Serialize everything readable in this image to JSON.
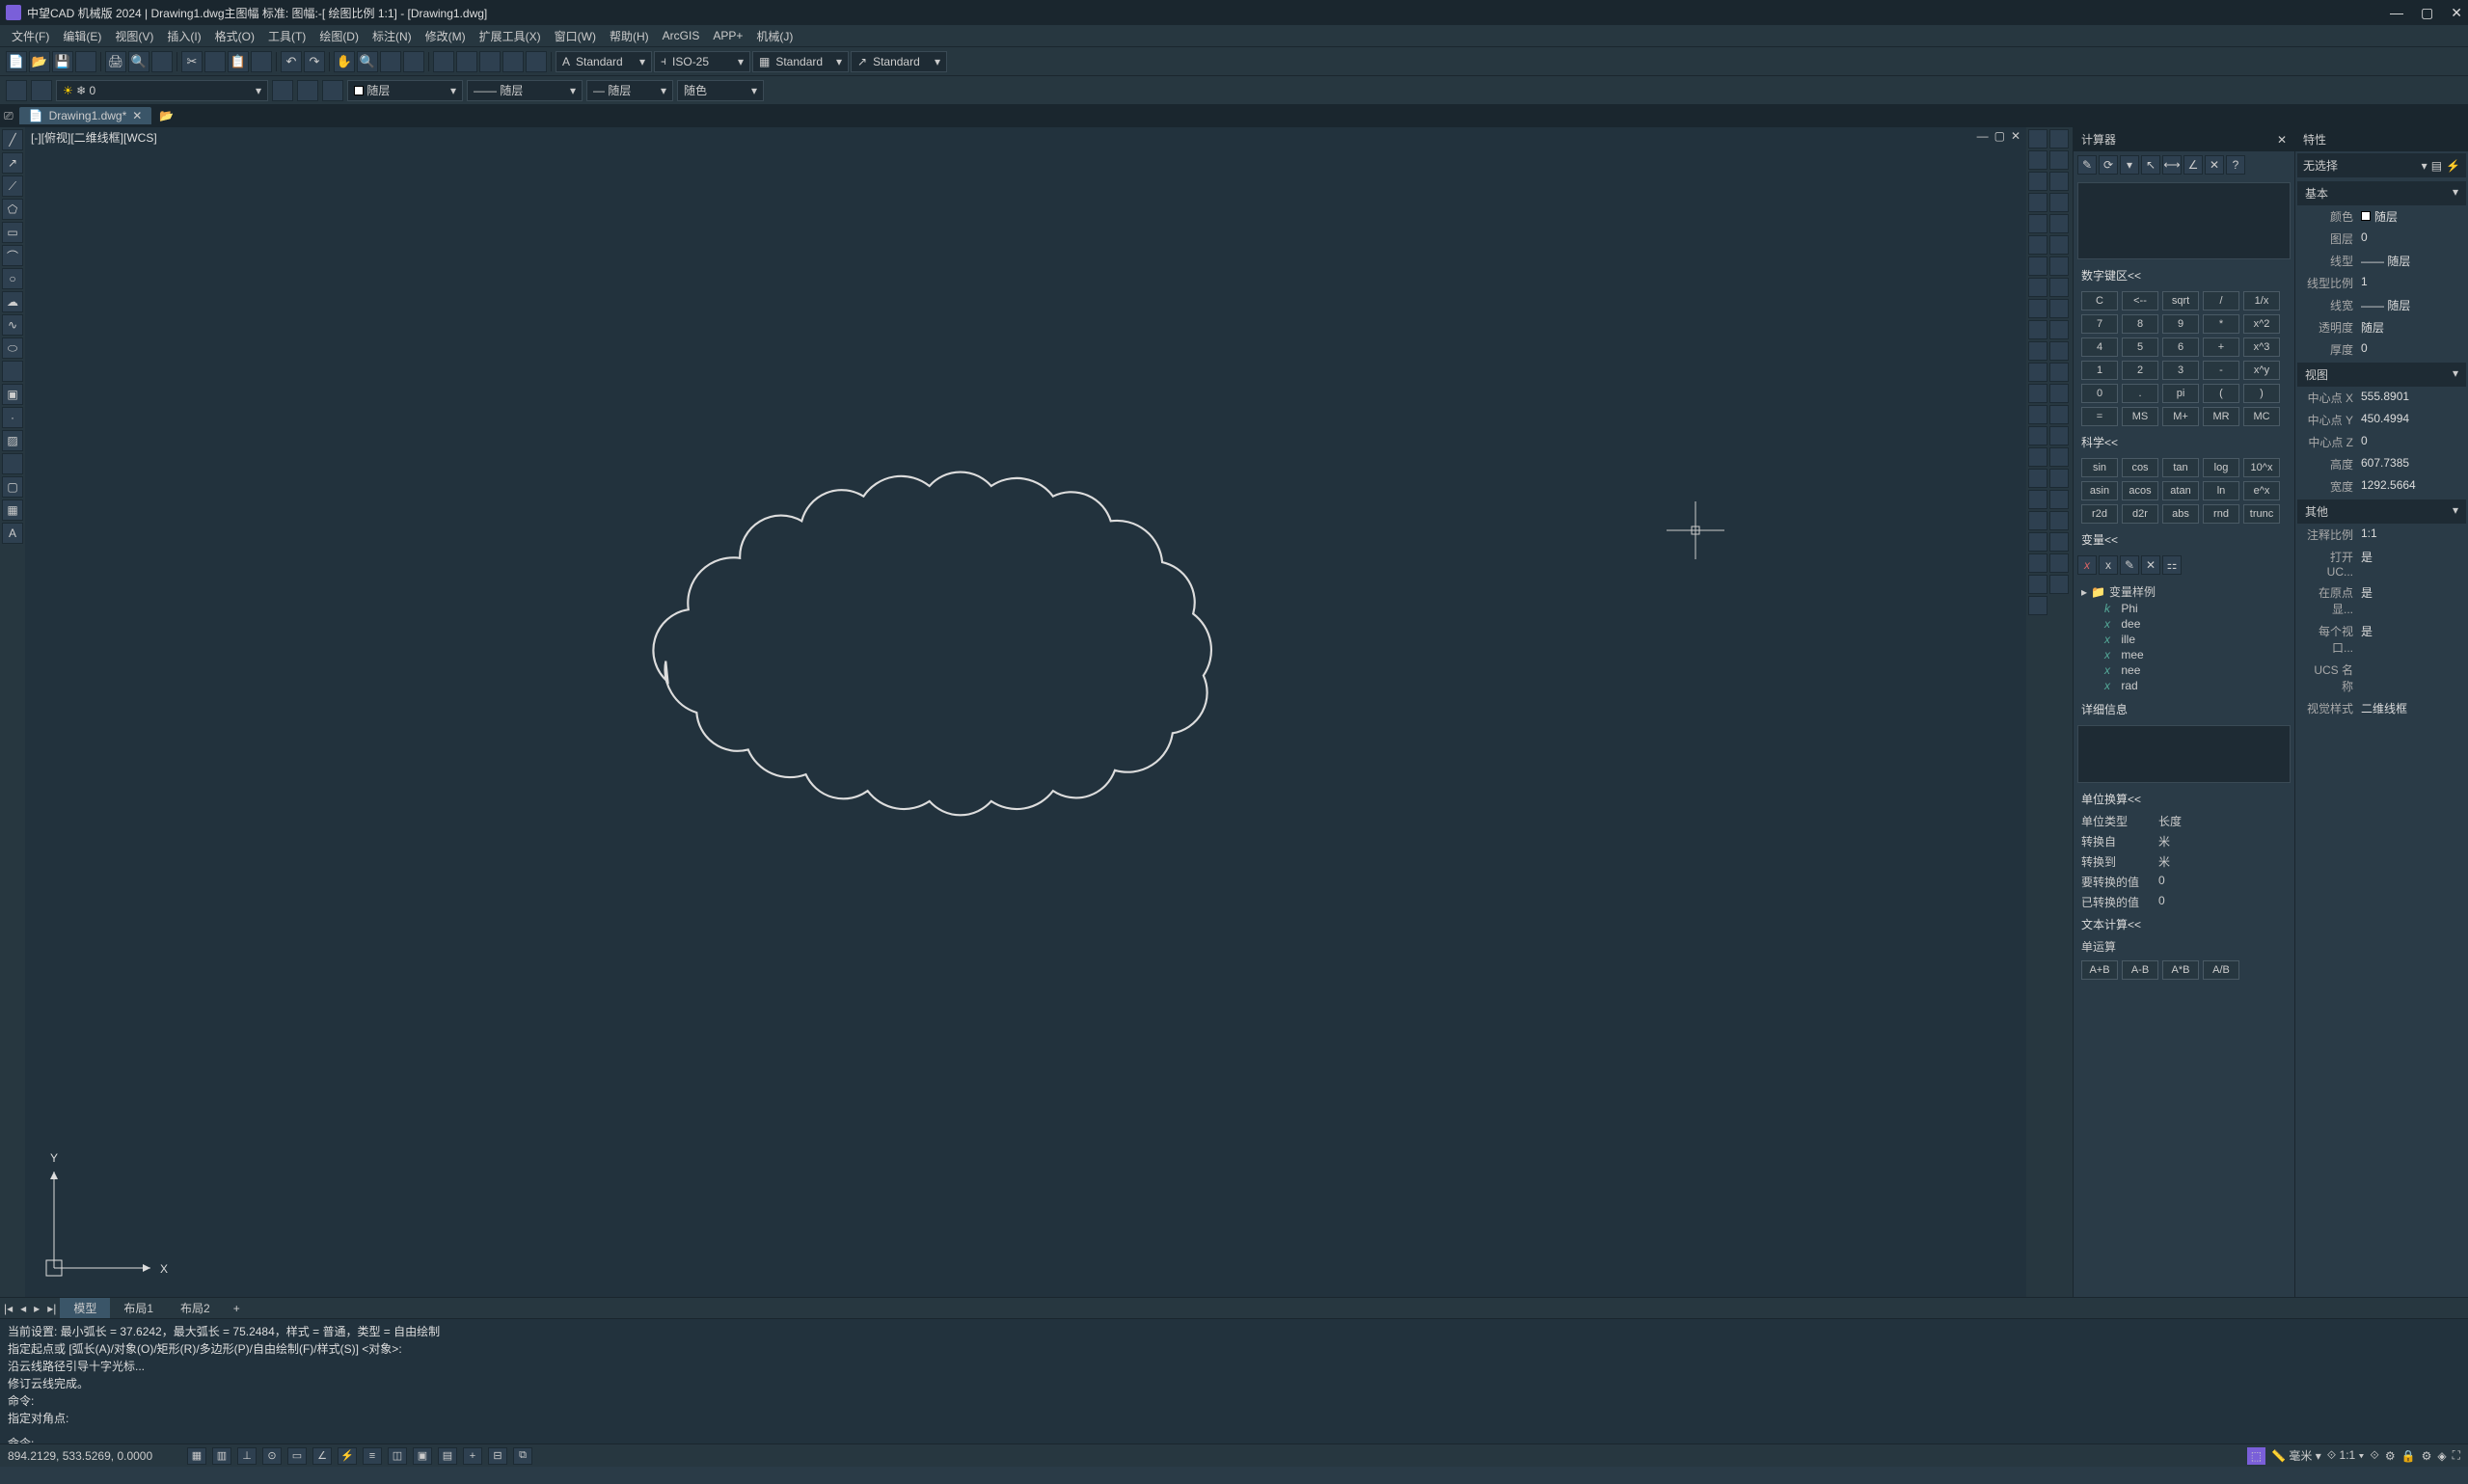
{
  "titlebar": {
    "text": "中望CAD 机械版 2024 | Drawing1.dwg主图幅  标准: 图幅:-[ 绘图比例 1:1] - [Drawing1.dwg]"
  },
  "menus": [
    "文件(F)",
    "编辑(E)",
    "视图(V)",
    "插入(I)",
    "格式(O)",
    "工具(T)",
    "绘图(D)",
    "标注(N)",
    "修改(M)",
    "扩展工具(X)",
    "窗口(W)",
    "帮助(H)",
    "ArcGIS",
    "APP+",
    "机械(J)"
  ],
  "style_dropdowns": {
    "text_style": "Standard",
    "dim_style": "ISO-25",
    "table_style": "Standard",
    "ml_style": "Standard"
  },
  "layer_bar": {
    "layer": "0",
    "color": "随层",
    "ltype": "随层",
    "lweight": "随层",
    "plot": "随色"
  },
  "doctab": {
    "name": "Drawing1.dwg*"
  },
  "canvas": {
    "header": "[-][俯视][二维线框][WCS]",
    "ucs_y": "Y",
    "ucs_x": "X"
  },
  "model_tabs": {
    "model": "模型",
    "layout1": "布局1",
    "layout2": "布局2"
  },
  "cmd": {
    "l1": "当前设置: 最小弧长 = 37.6242，最大弧长 = 75.2484，样式 = 普通，类型 = 自由绘制",
    "l2": "指定起点或 [弧长(A)/对象(O)/矩形(R)/多边形(P)/自由绘制(F)/样式(S)] <对象>:",
    "l3": "沿云线路径引导十字光标...",
    "l4": "修订云线完成。",
    "l5": "命令:",
    "l6": "指定对角点:",
    "prompt": "命令:"
  },
  "calc": {
    "title": "计算器",
    "s_num": "数字键区<<",
    "s_sci": "科学<<",
    "s_var": "变量<<",
    "s_det": "详细信息",
    "s_unit": "单位换算<<",
    "s_text": "文本计算<<",
    "s_single": "单运算",
    "num": [
      "C",
      "<--",
      "sqrt",
      "/",
      "1/x",
      "7",
      "8",
      "9",
      "*",
      "x^2",
      "4",
      "5",
      "6",
      "+",
      "x^3",
      "1",
      "2",
      "3",
      "-",
      "x^y",
      "0",
      ".",
      "pi",
      "(",
      ")",
      "=",
      "MS",
      "M+",
      "MR",
      "MC"
    ],
    "sci": [
      "sin",
      "cos",
      "tan",
      "log",
      "10^x",
      "asin",
      "acos",
      "atan",
      "ln",
      "e^x",
      "r2d",
      "d2r",
      "abs",
      "rnd",
      "trunc"
    ],
    "var_root": "变量样例",
    "vars": [
      "Phi",
      "dee",
      "ille",
      "mee",
      "nee",
      "rad"
    ],
    "unit_type_l": "单位类型",
    "unit_type_v": "长度",
    "unit_from_l": "转换自",
    "unit_from_v": "米",
    "unit_to_l": "转换到",
    "unit_to_v": "米",
    "unit_val_l": "要转换的值",
    "unit_val_v": "0",
    "unit_res_l": "已转换的值",
    "unit_res_v": "0",
    "text_ops": [
      "A+B",
      "A-B",
      "A*B",
      "A/B"
    ]
  },
  "props": {
    "title": "特性",
    "sel": "无选择",
    "sec_basic": "基本",
    "color_l": "颜色",
    "color_v": "随层",
    "layer_l": "图层",
    "layer_v": "0",
    "ltype_l": "线型",
    "ltype_v": "随层",
    "ltscale_l": "线型比例",
    "ltscale_v": "1",
    "lweight_l": "线宽",
    "lweight_v": "随层",
    "trans_l": "透明度",
    "trans_v": "随层",
    "thick_l": "厚度",
    "thick_v": "0",
    "sec_view": "视图",
    "cx_l": "中心点 X",
    "cx_v": "555.8901",
    "cy_l": "中心点 Y",
    "cy_v": "450.4994",
    "cz_l": "中心点 Z",
    "cz_v": "0",
    "h_l": "高度",
    "h_v": "607.7385",
    "w_l": "宽度",
    "w_v": "1292.5664",
    "sec_other": "其他",
    "annoscale_l": "注释比例",
    "annoscale_v": "1:1",
    "openuc_l": "打开 UC...",
    "openuc_v": "是",
    "atorig_l": "在原点显...",
    "atorig_v": "是",
    "pervp_l": "每个视口...",
    "pervp_v": "是",
    "ucsname_l": "UCS 名称",
    "ucsname_v": "",
    "vstyle_l": "视觉样式",
    "vstyle_v": "二维线框"
  },
  "status": {
    "coords": "894.2129, 533.5269, 0.0000",
    "units": "毫米",
    "scale": "1:1"
  }
}
